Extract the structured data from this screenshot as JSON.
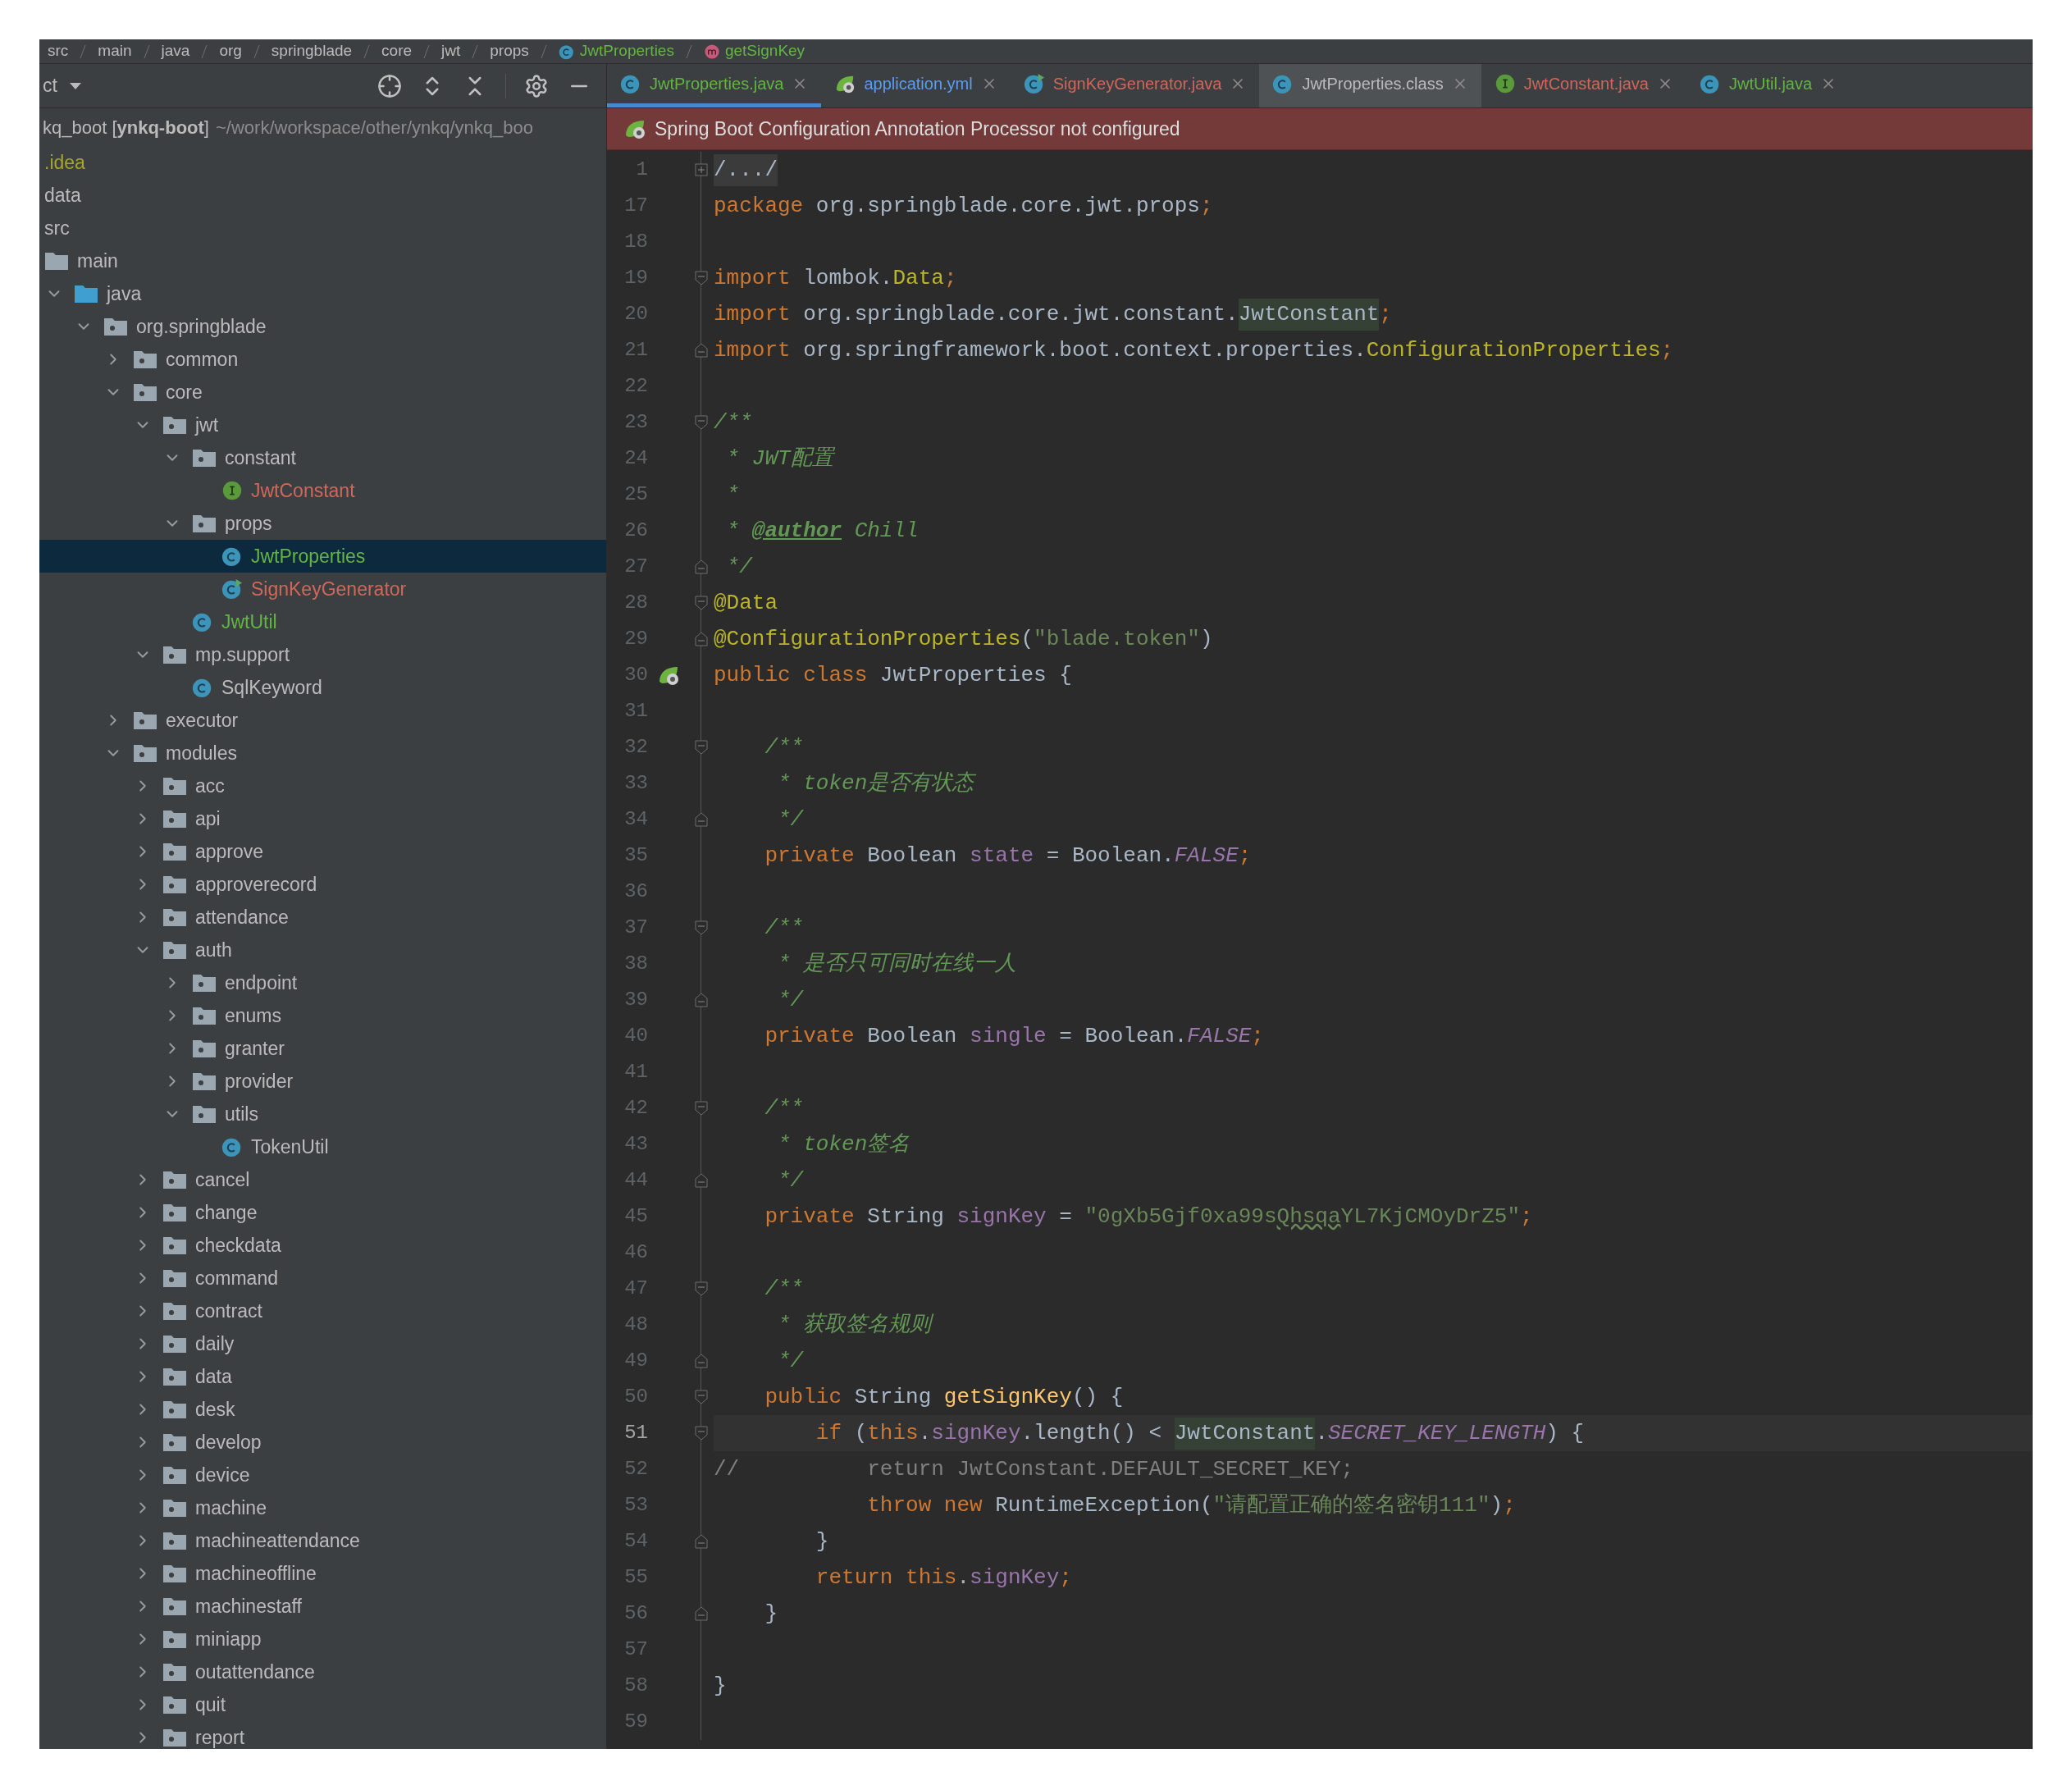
{
  "breadcrumb": [
    {
      "label": "src",
      "kind": "plain"
    },
    {
      "label": "main",
      "kind": "plain"
    },
    {
      "label": "java",
      "kind": "plain"
    },
    {
      "label": "org",
      "kind": "plain"
    },
    {
      "label": "springblade",
      "kind": "plain"
    },
    {
      "label": "core",
      "kind": "plain"
    },
    {
      "label": "jwt",
      "kind": "plain"
    },
    {
      "label": "props",
      "kind": "plain"
    },
    {
      "label": "JwtProperties",
      "kind": "class",
      "color": "#62b543"
    },
    {
      "label": "getSignKey",
      "kind": "method",
      "color": "#62b543"
    }
  ],
  "sidebar": {
    "title": "ct",
    "project": {
      "name": "kq_boot [**ynkq-boot**]",
      "path": "~/work/workspace/other/ynkq/ynkq_boo"
    },
    "tree": [
      {
        "label": ".idea",
        "kind": "plain",
        "color": "#a7a42c",
        "selected": false
      },
      {
        "label": "data",
        "kind": "plain",
        "selected": false
      },
      {
        "label": "src",
        "kind": "plain",
        "selected": false
      },
      {
        "label": "main",
        "kind": "folder",
        "selected": false,
        "children": [
          {
            "label": "java",
            "kind": "source-root",
            "expanded": true,
            "selected": false,
            "children": [
              {
                "label": "org.springblade",
                "kind": "package",
                "expanded": true,
                "selected": false,
                "children": [
                  {
                    "label": "common",
                    "kind": "package",
                    "expanded": false,
                    "selected": false
                  },
                  {
                    "label": "core",
                    "kind": "package",
                    "expanded": true,
                    "selected": false,
                    "children": [
                      {
                        "label": "jwt",
                        "kind": "package",
                        "expanded": true,
                        "selected": false,
                        "children": [
                          {
                            "label": "constant",
                            "kind": "package",
                            "expanded": true,
                            "selected": false,
                            "children": [
                              {
                                "label": "JwtConstant",
                                "kind": "interface",
                                "color": "#d1675a",
                                "selected": false
                              }
                            ]
                          },
                          {
                            "label": "props",
                            "kind": "package",
                            "expanded": true,
                            "selected": false,
                            "children": [
                              {
                                "label": "JwtProperties",
                                "kind": "class",
                                "color": "#62b543",
                                "selected": true
                              },
                              {
                                "label": "SignKeyGenerator",
                                "kind": "runnable-class",
                                "color": "#d1675a",
                                "selected": false
                              }
                            ]
                          },
                          {
                            "label": "JwtUtil",
                            "kind": "class",
                            "color": "#62b543",
                            "selected": false
                          }
                        ]
                      },
                      {
                        "label": "mp.support",
                        "kind": "package",
                        "expanded": true,
                        "selected": false,
                        "children": [
                          {
                            "label": "SqlKeyword",
                            "kind": "class",
                            "selected": false
                          }
                        ]
                      }
                    ]
                  },
                  {
                    "label": "executor",
                    "kind": "package",
                    "expanded": false,
                    "selected": false
                  },
                  {
                    "label": "modules",
                    "kind": "package",
                    "expanded": true,
                    "selected": false,
                    "children": [
                      {
                        "label": "acc",
                        "kind": "package",
                        "expanded": false,
                        "selected": false
                      },
                      {
                        "label": "api",
                        "kind": "package",
                        "expanded": false,
                        "selected": false
                      },
                      {
                        "label": "approve",
                        "kind": "package",
                        "expanded": false,
                        "selected": false
                      },
                      {
                        "label": "approverecord",
                        "kind": "package",
                        "expanded": false,
                        "selected": false
                      },
                      {
                        "label": "attendance",
                        "kind": "package",
                        "expanded": false,
                        "selected": false
                      },
                      {
                        "label": "auth",
                        "kind": "package",
                        "expanded": true,
                        "selected": false,
                        "children": [
                          {
                            "label": "endpoint",
                            "kind": "package",
                            "expanded": false,
                            "selected": false
                          },
                          {
                            "label": "enums",
                            "kind": "package",
                            "expanded": false,
                            "selected": false
                          },
                          {
                            "label": "granter",
                            "kind": "package",
                            "expanded": false,
                            "selected": false
                          },
                          {
                            "label": "provider",
                            "kind": "package",
                            "expanded": false,
                            "selected": false
                          },
                          {
                            "label": "utils",
                            "kind": "package",
                            "expanded": true,
                            "selected": false,
                            "children": [
                              {
                                "label": "TokenUtil",
                                "kind": "class",
                                "selected": false
                              }
                            ]
                          }
                        ]
                      },
                      {
                        "label": "cancel",
                        "kind": "package",
                        "expanded": false,
                        "selected": false
                      },
                      {
                        "label": "change",
                        "kind": "package",
                        "expanded": false,
                        "selected": false
                      },
                      {
                        "label": "checkdata",
                        "kind": "package",
                        "expanded": false,
                        "selected": false
                      },
                      {
                        "label": "command",
                        "kind": "package",
                        "expanded": false,
                        "selected": false
                      },
                      {
                        "label": "contract",
                        "kind": "package",
                        "expanded": false,
                        "selected": false
                      },
                      {
                        "label": "daily",
                        "kind": "package",
                        "expanded": false,
                        "selected": false
                      },
                      {
                        "label": "data",
                        "kind": "package",
                        "expanded": false,
                        "selected": false
                      },
                      {
                        "label": "desk",
                        "kind": "package",
                        "expanded": false,
                        "selected": false
                      },
                      {
                        "label": "develop",
                        "kind": "package",
                        "expanded": false,
                        "selected": false
                      },
                      {
                        "label": "device",
                        "kind": "package",
                        "expanded": false,
                        "selected": false
                      },
                      {
                        "label": "machine",
                        "kind": "package",
                        "expanded": false,
                        "selected": false
                      },
                      {
                        "label": "machineattendance",
                        "kind": "package",
                        "expanded": false,
                        "selected": false
                      },
                      {
                        "label": "machineoffline",
                        "kind": "package",
                        "expanded": false,
                        "selected": false
                      },
                      {
                        "label": "machinestaff",
                        "kind": "package",
                        "expanded": false,
                        "selected": false
                      },
                      {
                        "label": "miniapp",
                        "kind": "package",
                        "expanded": false,
                        "selected": false
                      },
                      {
                        "label": "outattendance",
                        "kind": "package",
                        "expanded": false,
                        "selected": false
                      },
                      {
                        "label": "quit",
                        "kind": "package",
                        "expanded": false,
                        "selected": false
                      },
                      {
                        "label": "report",
                        "kind": "package",
                        "expanded": false,
                        "selected": false
                      }
                    ]
                  }
                ]
              }
            ]
          }
        ]
      }
    ]
  },
  "tabs": [
    {
      "label": "JwtProperties.java",
      "kind": "class",
      "color": "#62b543",
      "selected": true,
      "hovered": false
    },
    {
      "label": "application.yml",
      "kind": "spring",
      "color": "#589df6",
      "selected": false,
      "hovered": false
    },
    {
      "label": "SignKeyGenerator.java",
      "kind": "runnable-class",
      "color": "#d1675a",
      "selected": false,
      "hovered": false
    },
    {
      "label": "JwtProperties.class",
      "kind": "class",
      "color": "#bbbbbb",
      "selected": false,
      "hovered": true
    },
    {
      "label": "JwtConstant.java",
      "kind": "interface",
      "color": "#d1675a",
      "selected": false,
      "hovered": false
    },
    {
      "label": "JwtUtil.java",
      "kind": "class",
      "color": "#62b543",
      "selected": false,
      "hovered": false
    }
  ],
  "notification": {
    "text": "Spring Boot Configuration Annotation Processor not configured"
  },
  "code": [
    {
      "number": "1",
      "current": false,
      "kind": "fold-collapsed",
      "tokens": [
        {
          "text": "/.../",
          "kind": "folded"
        }
      ]
    },
    {
      "number": "17",
      "current": false,
      "kind": "plain",
      "tokens": [
        {
          "text": "package",
          "kind": "keyword"
        },
        {
          "text": " org.springblade.core.jwt.props",
          "kind": "plain"
        },
        {
          "text": ";",
          "kind": "keyword"
        }
      ]
    },
    {
      "number": "18",
      "current": false,
      "kind": "plain"
    },
    {
      "number": "19",
      "current": false,
      "kind": "fold-start",
      "tokens": [
        {
          "text": "import",
          "kind": "keyword"
        },
        {
          "text": " lombok.",
          "kind": "plain"
        },
        {
          "text": "Data",
          "kind": "annotation"
        },
        {
          "text": ";",
          "kind": "keyword"
        }
      ]
    },
    {
      "number": "20",
      "current": false,
      "kind": "plain",
      "tokens": [
        {
          "text": "import",
          "kind": "keyword"
        },
        {
          "text": " org.springblade.core.jwt.constant.",
          "kind": "plain"
        },
        {
          "text": "JwtConstant",
          "kind": "usage"
        },
        {
          "text": ";",
          "kind": "keyword"
        }
      ]
    },
    {
      "number": "21",
      "current": false,
      "kind": "fold-end",
      "tokens": [
        {
          "text": "import",
          "kind": "keyword"
        },
        {
          "text": " org.springframework.boot.context.properties.",
          "kind": "plain"
        },
        {
          "text": "ConfigurationProperties",
          "kind": "annotation"
        },
        {
          "text": ";",
          "kind": "keyword"
        }
      ]
    },
    {
      "number": "22",
      "current": false,
      "kind": "plain"
    },
    {
      "number": "23",
      "current": false,
      "kind": "fold-start",
      "tokens": [
        {
          "text": "/**",
          "kind": "doc"
        }
      ]
    },
    {
      "number": "24",
      "current": false,
      "kind": "plain",
      "tokens": [
        {
          "text": " * JWT配置",
          "kind": "doc"
        }
      ]
    },
    {
      "number": "25",
      "current": false,
      "kind": "plain",
      "tokens": [
        {
          "text": " *",
          "kind": "doc"
        }
      ]
    },
    {
      "number": "26",
      "current": false,
      "kind": "plain",
      "tokens": [
        {
          "text": " * ",
          "kind": "doc"
        },
        {
          "text": "@author",
          "kind": "doc-tag"
        },
        {
          "text": " Chill",
          "kind": "doc"
        }
      ]
    },
    {
      "number": "27",
      "current": false,
      "kind": "fold-end",
      "tokens": [
        {
          "text": " */",
          "kind": "doc"
        }
      ]
    },
    {
      "number": "28",
      "current": false,
      "kind": "fold-start",
      "tokens": [
        {
          "text": "@Data",
          "kind": "annotation"
        }
      ]
    },
    {
      "number": "29",
      "current": false,
      "kind": "fold-end",
      "tokens": [
        {
          "text": "@ConfigurationProperties",
          "kind": "annotation"
        },
        {
          "text": "(",
          "kind": "plain"
        },
        {
          "text": "\"blade.token\"",
          "kind": "string"
        },
        {
          "text": ")",
          "kind": "plain"
        }
      ]
    },
    {
      "number": "30",
      "current": false,
      "kind": "bean-marker",
      "tokens": [
        {
          "text": "public class",
          "kind": "keyword"
        },
        {
          "text": " JwtProperties {",
          "kind": "plain"
        }
      ]
    },
    {
      "number": "31",
      "current": false,
      "kind": "plain"
    },
    {
      "number": "32",
      "current": false,
      "kind": "fold-start",
      "tokens": [
        {
          "text": "    /**",
          "kind": "doc"
        }
      ]
    },
    {
      "number": "33",
      "current": false,
      "kind": "plain",
      "tokens": [
        {
          "text": "     * token是否有状态",
          "kind": "doc"
        }
      ]
    },
    {
      "number": "34",
      "current": false,
      "kind": "fold-end",
      "tokens": [
        {
          "text": "     */",
          "kind": "doc"
        }
      ]
    },
    {
      "number": "35",
      "current": false,
      "kind": "plain",
      "tokens": [
        {
          "text": "    private",
          "kind": "keyword"
        },
        {
          "text": " Boolean ",
          "kind": "plain"
        },
        {
          "text": "state",
          "kind": "field"
        },
        {
          "text": " = Boolean.",
          "kind": "plain"
        },
        {
          "text": "FALSE",
          "kind": "constant"
        },
        {
          "text": ";",
          "kind": "keyword"
        }
      ]
    },
    {
      "number": "36",
      "current": false,
      "kind": "plain"
    },
    {
      "number": "37",
      "current": false,
      "kind": "fold-start",
      "tokens": [
        {
          "text": "    /**",
          "kind": "doc"
        }
      ]
    },
    {
      "number": "38",
      "current": false,
      "kind": "plain",
      "tokens": [
        {
          "text": "     * 是否只可同时在线一人",
          "kind": "doc"
        }
      ]
    },
    {
      "number": "39",
      "current": false,
      "kind": "fold-end",
      "tokens": [
        {
          "text": "     */",
          "kind": "doc"
        }
      ]
    },
    {
      "number": "40",
      "current": false,
      "kind": "plain",
      "tokens": [
        {
          "text": "    private",
          "kind": "keyword"
        },
        {
          "text": " Boolean ",
          "kind": "plain"
        },
        {
          "text": "single",
          "kind": "field"
        },
        {
          "text": " = Boolean.",
          "kind": "plain"
        },
        {
          "text": "FALSE",
          "kind": "constant"
        },
        {
          "text": ";",
          "kind": "keyword"
        }
      ]
    },
    {
      "number": "41",
      "current": false,
      "kind": "plain"
    },
    {
      "number": "42",
      "current": false,
      "kind": "fold-start",
      "tokens": [
        {
          "text": "    /**",
          "kind": "doc"
        }
      ]
    },
    {
      "number": "43",
      "current": false,
      "kind": "plain",
      "tokens": [
        {
          "text": "     * token签名",
          "kind": "doc"
        }
      ]
    },
    {
      "number": "44",
      "current": false,
      "kind": "fold-end",
      "tokens": [
        {
          "text": "     */",
          "kind": "doc"
        }
      ]
    },
    {
      "number": "45",
      "current": false,
      "kind": "plain",
      "tokens": [
        {
          "text": "    private",
          "kind": "keyword"
        },
        {
          "text": " String ",
          "kind": "plain"
        },
        {
          "text": "signKey",
          "kind": "field"
        },
        {
          "text": " = ",
          "kind": "plain"
        },
        {
          "text": "\"0gXb5Gjf0xa99s",
          "kind": "string"
        },
        {
          "text": "Qhsqa",
          "kind": "typo-string"
        },
        {
          "text": "YL7KjCMOyDrZ5\"",
          "kind": "string"
        },
        {
          "text": ";",
          "kind": "keyword"
        }
      ]
    },
    {
      "number": "46",
      "current": false,
      "kind": "plain"
    },
    {
      "number": "47",
      "current": false,
      "kind": "fold-start",
      "tokens": [
        {
          "text": "    /**",
          "kind": "doc"
        }
      ]
    },
    {
      "number": "48",
      "current": false,
      "kind": "plain",
      "tokens": [
        {
          "text": "     * 获取签名规则",
          "kind": "doc"
        }
      ]
    },
    {
      "number": "49",
      "current": false,
      "kind": "fold-end",
      "tokens": [
        {
          "text": "     */",
          "kind": "doc"
        }
      ]
    },
    {
      "number": "50",
      "current": false,
      "kind": "fold-start",
      "tokens": [
        {
          "text": "    public",
          "kind": "keyword"
        },
        {
          "text": " String ",
          "kind": "plain"
        },
        {
          "text": "getSignKey",
          "kind": "method"
        },
        {
          "text": "() {",
          "kind": "plain"
        }
      ]
    },
    {
      "number": "51",
      "current": true,
      "kind": "fold-start",
      "tokens": [
        {
          "text": "        if",
          "kind": "keyword"
        },
        {
          "text": " (",
          "kind": "plain"
        },
        {
          "text": "this",
          "kind": "keyword"
        },
        {
          "text": ".",
          "kind": "plain"
        },
        {
          "text": "signKey",
          "kind": "field"
        },
        {
          "text": ".length() < ",
          "kind": "plain"
        },
        {
          "text": "JwtConstant",
          "kind": "usage"
        },
        {
          "text": ".",
          "kind": "plain"
        },
        {
          "text": "SECRET_KEY_LENGTH",
          "kind": "constant"
        },
        {
          "text": ") {",
          "kind": "plain"
        }
      ]
    },
    {
      "number": "52",
      "current": false,
      "kind": "plain",
      "tokens": [
        {
          "text": "//          return JwtConstant.DEFAULT_SECRET_KEY;",
          "kind": "disabled"
        }
      ]
    },
    {
      "number": "53",
      "current": false,
      "kind": "plain",
      "tokens": [
        {
          "text": "            throw new",
          "kind": "keyword"
        },
        {
          "text": " RuntimeException(",
          "kind": "plain"
        },
        {
          "text": "\"请配置正确的签名密钥111\"",
          "kind": "string"
        },
        {
          "text": ")",
          "kind": "plain"
        },
        {
          "text": ";",
          "kind": "keyword"
        }
      ]
    },
    {
      "number": "54",
      "current": false,
      "kind": "fold-end",
      "tokens": [
        {
          "text": "        }",
          "kind": "plain"
        }
      ]
    },
    {
      "number": "55",
      "current": false,
      "kind": "plain",
      "tokens": [
        {
          "text": "        return ",
          "kind": "keyword"
        },
        {
          "text": "this",
          "kind": "keyword"
        },
        {
          "text": ".",
          "kind": "plain"
        },
        {
          "text": "signKey",
          "kind": "field"
        },
        {
          "text": ";",
          "kind": "keyword"
        }
      ]
    },
    {
      "number": "56",
      "current": false,
      "kind": "fold-end",
      "tokens": [
        {
          "text": "    }",
          "kind": "plain"
        }
      ]
    },
    {
      "number": "57",
      "current": false,
      "kind": "plain"
    },
    {
      "number": "58",
      "current": false,
      "kind": "plain",
      "tokens": [
        {
          "text": "}",
          "kind": "plain"
        }
      ]
    },
    {
      "number": "59",
      "current": false,
      "kind": "plain"
    }
  ]
}
